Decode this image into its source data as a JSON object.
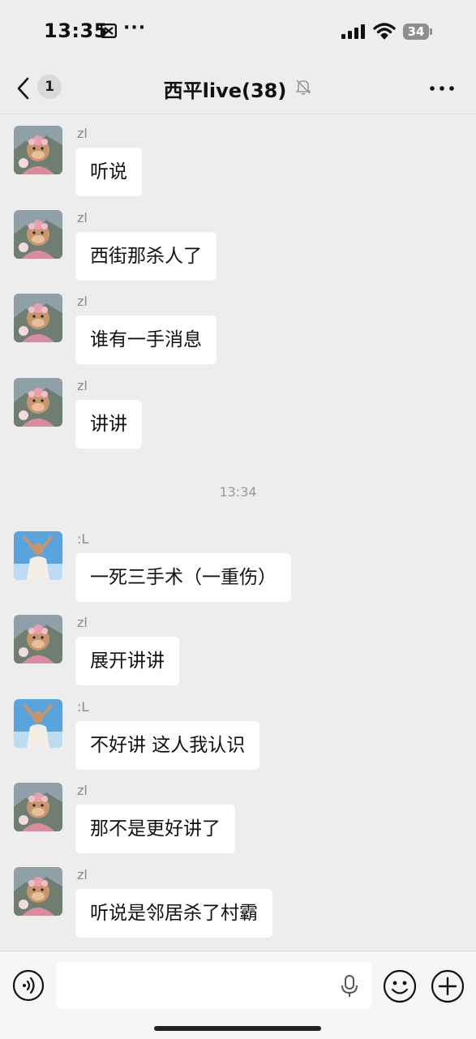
{
  "status_bar": {
    "time": "13:35",
    "more": "···",
    "battery": "34",
    "icons": [
      "capcut-icon",
      "signal-icon",
      "wifi-icon",
      "battery-icon"
    ]
  },
  "nav": {
    "unread_count": "1",
    "title": "西平live(38)",
    "icons": [
      "back-chevron-icon",
      "mute-bell-icon",
      "more-icon"
    ]
  },
  "messages": [
    {
      "sender": "zl",
      "text": "听说",
      "avatar": "monkey-avatar"
    },
    {
      "sender": "zl",
      "text": "西街那杀人了",
      "avatar": "monkey-avatar"
    },
    {
      "sender": "zl",
      "text": "谁有一手消息",
      "avatar": "monkey-avatar"
    },
    {
      "sender": "zl",
      "text": "讲讲",
      "avatar": "monkey-avatar"
    },
    {
      "sender": ":L",
      "text": "一死三手术（一重伤）",
      "avatar": "person-avatar"
    },
    {
      "sender": "zl",
      "text": "展开讲讲",
      "avatar": "monkey-avatar"
    },
    {
      "sender": ":L",
      "text": "不好讲 这人我认识",
      "avatar": "person-avatar"
    },
    {
      "sender": "zl",
      "text": "那不是更好讲了",
      "avatar": "monkey-avatar"
    },
    {
      "sender": "zl",
      "text": "听说是邻居杀了村霸",
      "avatar": "monkey-avatar"
    }
  ],
  "timestamp": "13:34",
  "input_bar": {
    "value": "",
    "icons": [
      "voice-icon",
      "mic-icon",
      "emoji-icon",
      "plus-icon"
    ]
  }
}
